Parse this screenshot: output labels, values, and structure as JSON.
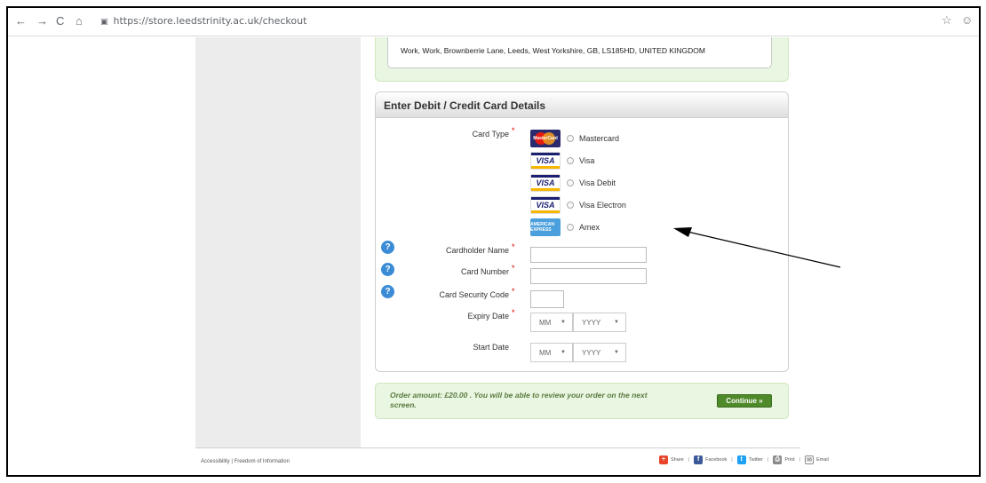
{
  "browser": {
    "back": "←",
    "forward": "→",
    "reload": "C",
    "home": "⌂",
    "url": "https://store.leedstrinity.ac.uk/checkout",
    "star": "☆",
    "profile": "☺"
  },
  "address": {
    "text": "Work, Work, Brownberrie Lane, Leeds, West Yorkshire, GB, LS185HD, UNITED KINGDOM"
  },
  "card_form": {
    "title": "Enter Debit / Credit Card Details",
    "card_type_label": "Card Type",
    "required_mark": "*",
    "options": [
      {
        "label": "Mastercard",
        "logo": "mastercard-logo"
      },
      {
        "label": "Visa",
        "logo": "visa-logo"
      },
      {
        "label": "Visa Debit",
        "logo": "visa-logo"
      },
      {
        "label": "Visa Electron",
        "logo": "visa-logo"
      },
      {
        "label": "Amex",
        "logo": "amex-logo"
      }
    ],
    "visa_logo_text": "VISA",
    "mastercard_logo_text": "MasterCard",
    "amex_logo_text": "AMERICAN EXPRESS",
    "help_glyph": "?",
    "cardholder_label": "Cardholder Name",
    "card_number_label": "Card Number",
    "security_code_label": "Card Security Code",
    "expiry_label": "Expiry Date",
    "start_label": "Start Date",
    "month_placeholder": "MM",
    "year_placeholder": "YYYY",
    "select_arrow": "▼"
  },
  "order": {
    "text": "Order amount: £20.00 . You will be able to review your order on the next screen.",
    "continue_label": "Continue »"
  },
  "footer": {
    "left": "Accessibility  |  Freedom of Information",
    "share": "Share",
    "facebook": "Facebook",
    "twitter": "Twitter",
    "print": "Print",
    "email": "Email",
    "sep": "|"
  }
}
